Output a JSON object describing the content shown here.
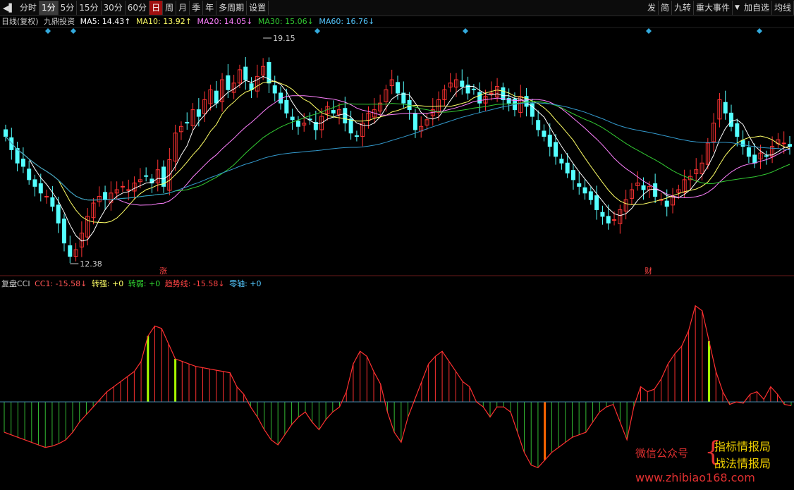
{
  "toolbar": {
    "left": [
      "分时",
      "1分",
      "5分",
      "15分",
      "30分",
      "60分",
      "日",
      "周",
      "月",
      "季",
      "年",
      "多周期",
      "设置"
    ],
    "right": [
      "发",
      "简",
      "九转",
      "重大事件",
      "加自选",
      "均线"
    ],
    "arrow_icon": "left-arrow-icon",
    "dropdown_icon": "chevron-down-icon"
  },
  "info": {
    "period": "日线(复权)",
    "name": "九鼎投资",
    "ma5": "MA5: 14.43↑",
    "ma10": "MA10: 13.92↑",
    "ma20": "MA20: 14.05↓",
    "ma30": "MA30: 15.06↓",
    "ma60": "MA60: 16.76↓"
  },
  "indicator_info": {
    "name": "复盘CCI",
    "cc1": "CC1: -15.58↓",
    "strong": "转强: +0",
    "weak": "转弱: +0",
    "trend": "趋势线: -15.58↓",
    "zero": "零轴: +0"
  },
  "annotations": {
    "high": "19.15",
    "low": "12.38",
    "mark1": "涨",
    "mark2": "财"
  },
  "watermark": {
    "label": "微信公众号",
    "line1": "指标情报局",
    "line2": "战法情报局",
    "url": "www.zhibiao168.com"
  },
  "colors": {
    "up": "#ff3333",
    "down": "#54ffff",
    "ma5": "#ffffff",
    "ma10": "#ffff66",
    "ma20": "#ff80ff",
    "ma30": "#33cc33",
    "ma60": "#3399cc",
    "cci_line": "#ff3030",
    "cci_pos": "#ff3030",
    "cci_neg": "#33bb33",
    "cci_strong": "#aaff00",
    "zero": "#4488aa",
    "diamond": "#33aadd"
  },
  "chart_data": [
    {
      "type": "candlestick",
      "price_high": 19.15,
      "price_low": 12.38,
      "closes": [
        16.2,
        15.8,
        15.4,
        15.3,
        14.9,
        14.7,
        14.5,
        14.4,
        14.1,
        13.6,
        13.0,
        12.6,
        12.8,
        13.3,
        13.8,
        14.2,
        14.4,
        14.3,
        14.5,
        14.6,
        14.7,
        14.6,
        14.8,
        14.9,
        15.0,
        14.8,
        15.2,
        14.7,
        15.5,
        16.3,
        16.5,
        16.6,
        17.0,
        16.8,
        17.3,
        17.6,
        17.2,
        17.9,
        17.6,
        17.8,
        18.2,
        17.9,
        17.6,
        18.0,
        18.3,
        17.8,
        17.5,
        17.2,
        16.9,
        16.7,
        16.5,
        16.6,
        16.7,
        16.4,
        16.8,
        17.1,
        16.9,
        17.0,
        16.6,
        16.3,
        16.2,
        16.6,
        16.9,
        17.0,
        17.2,
        17.6,
        17.9,
        17.5,
        17.2,
        17.0,
        16.4,
        16.5,
        16.7,
        17.0,
        17.3,
        17.6,
        17.8,
        17.9,
        17.7,
        17.5,
        17.6,
        17.2,
        17.4,
        17.5,
        17.7,
        17.3,
        17.2,
        17.0,
        17.4,
        17.1,
        16.8,
        16.4,
        16.2,
        15.9,
        15.6,
        15.4,
        15.1,
        14.9,
        14.7,
        14.5,
        14.3,
        14.0,
        13.8,
        13.6,
        13.7,
        14.0,
        14.3,
        14.6,
        14.8,
        14.6,
        14.7,
        14.4,
        14.3,
        14.1,
        14.4,
        14.6,
        14.9,
        15.0,
        15.2,
        15.4,
        16.0,
        16.6,
        17.3,
        16.9,
        16.5,
        16.2,
        15.9,
        15.6,
        15.4,
        15.7,
        15.6,
        15.9,
        16.1,
        16.0,
        15.9
      ]
    },
    {
      "type": "bar",
      "name": "复盘CCI",
      "zero": 0,
      "values": [
        -120,
        -130,
        -140,
        -150,
        -160,
        -170,
        -180,
        -175,
        -165,
        -150,
        -120,
        -80,
        -50,
        -20,
        10,
        40,
        60,
        80,
        100,
        120,
        160,
        260,
        300,
        290,
        230,
        170,
        160,
        150,
        140,
        135,
        130,
        125,
        120,
        115,
        60,
        30,
        -20,
        -60,
        -110,
        -150,
        -170,
        -130,
        -90,
        -60,
        -40,
        -80,
        -110,
        -70,
        -40,
        -20,
        40,
        150,
        200,
        180,
        120,
        70,
        -40,
        -120,
        -160,
        -60,
        10,
        80,
        150,
        180,
        200,
        160,
        120,
        80,
        60,
        0,
        -20,
        -60,
        -20,
        -20,
        -40,
        -120,
        -200,
        -250,
        -260,
        -230,
        -200,
        -180,
        -160,
        -140,
        -130,
        -120,
        -80,
        -40,
        -20,
        -10,
        -80,
        -150,
        -20,
        60,
        40,
        50,
        90,
        150,
        190,
        220,
        280,
        380,
        360,
        240,
        120,
        40,
        -10,
        0,
        -5,
        30,
        40,
        10,
        60,
        30,
        -10,
        -15
      ]
    }
  ]
}
